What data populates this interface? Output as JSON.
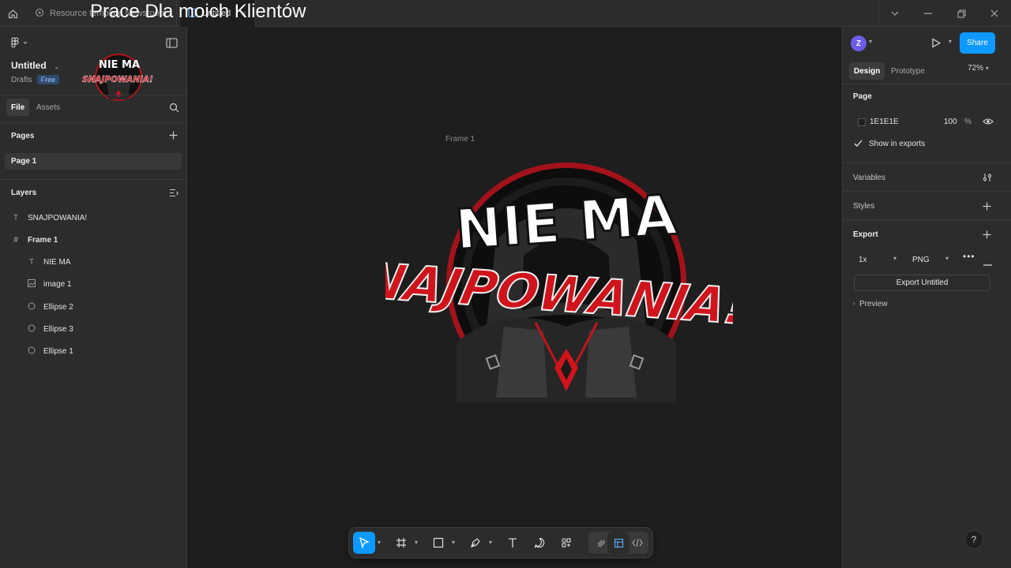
{
  "titlebar": {
    "tab1_label": "Resource template Newsroom",
    "tab2_label": "Untitled",
    "overlay_title": "Prace Dla moich Klientów"
  },
  "file": {
    "name": "Untitled",
    "location": "Drafts",
    "plan_badge": "Free"
  },
  "left_tabs": {
    "file": "File",
    "assets": "Assets"
  },
  "pages": {
    "title": "Pages",
    "items": [
      "Page 1"
    ]
  },
  "layers": {
    "title": "Layers",
    "items": [
      {
        "name": "SNAJPOWANIA!",
        "icon": "text-icon"
      },
      {
        "name": "Frame 1",
        "icon": "frame-icon"
      },
      {
        "name": "NIE MA",
        "icon": "text-icon"
      },
      {
        "name": "image 1",
        "icon": "image-icon"
      },
      {
        "name": "Ellipse 2",
        "icon": "ellipse-icon"
      },
      {
        "name": "Ellipse 3",
        "icon": "ellipse-icon"
      },
      {
        "name": "Ellipse 1",
        "icon": "ellipse-icon"
      }
    ]
  },
  "canvas": {
    "frame_label": "Frame 1",
    "logo_top": "NIE MA",
    "logo_bottom": "SNAJPOWANIA!"
  },
  "right": {
    "avatar_initial": "Z",
    "share_label": "Share",
    "tab_design": "Design",
    "tab_prototype": "Prototype",
    "zoom": "72%",
    "page_section": "Page",
    "bg_hex": "1E1E1E",
    "bg_opacity": "100",
    "opacity_unit": "%",
    "show_in_exports": "Show in exports",
    "variables": "Variables",
    "styles": "Styles",
    "export": "Export",
    "export_scale": "1x",
    "export_format": "PNG",
    "export_button": "Export Untitled",
    "preview": "Preview",
    "help": "?"
  },
  "colors": {
    "accent": "#0d99ff",
    "canvas_bg": "#1e1e1e",
    "panel_bg": "#2c2c2c",
    "logo_red": "#d0141c"
  }
}
